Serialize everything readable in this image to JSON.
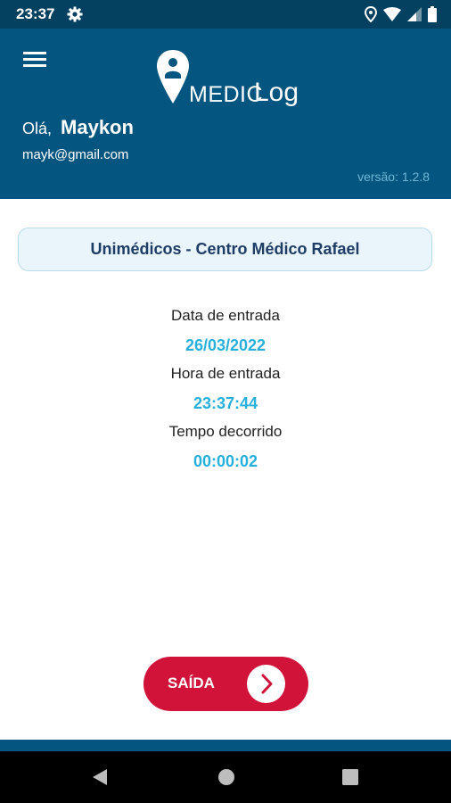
{
  "status_bar": {
    "time": "23:37",
    "icons": [
      "gear-icon",
      "location-icon",
      "wifi-icon",
      "signal-icon",
      "battery-icon"
    ]
  },
  "header": {
    "logo_medic": "MEDIC",
    "logo_log": "Log",
    "greeting": "Olá,",
    "user_name": "Maykon",
    "email": "mayk@gmail.com",
    "version": "versão: 1.2.8"
  },
  "clinic": {
    "name": "Unimédicos - Centro Médico Rafael"
  },
  "entry": {
    "date_label": "Data de entrada",
    "date_value": "26/03/2022",
    "time_label": "Hora de entrada",
    "time_value": "23:37:44",
    "elapsed_label": "Tempo decorrido",
    "elapsed_value": "00:00:02"
  },
  "exit_button": {
    "label": "SAÍDA",
    "icon": "chevron-right-icon"
  },
  "colors": {
    "header_bg": "#045680",
    "status_bg": "#04405f",
    "accent": "#27b0dc",
    "exit": "#d1133a",
    "clinic_text": "#1d3c66"
  },
  "nav_bar": {
    "icons": [
      "back-icon",
      "home-icon",
      "recents-icon"
    ]
  }
}
